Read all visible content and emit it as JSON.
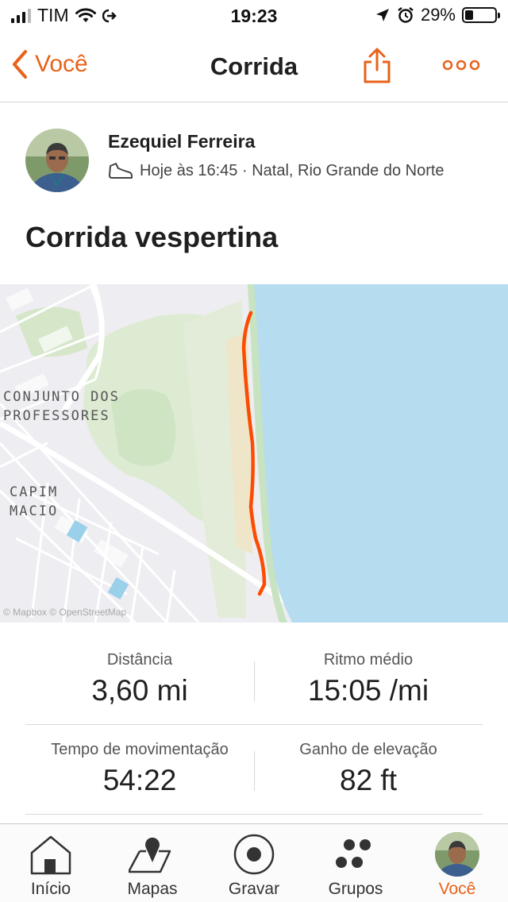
{
  "status_bar": {
    "carrier": "TIM",
    "time": "19:23",
    "battery": "29%",
    "battery_level": 0.29
  },
  "nav": {
    "back_label": "Você",
    "title": "Corrida"
  },
  "athlete": {
    "name": "Ezequiel Ferreira",
    "meta": "Hoje às 16:45 · Natal, Rio Grande do Norte"
  },
  "activity": {
    "title": "Corrida vespertina"
  },
  "map": {
    "labels": {
      "conjunto": "CONJUNTO DOS",
      "professores": "PROFESSORES",
      "capim": "CAPIM",
      "macio": "MACIO"
    },
    "attribution": "© Mapbox © OpenStreetMap",
    "route_color": "#fc4c02",
    "water_color": "#b5dcef"
  },
  "stats": [
    {
      "label": "Distância",
      "value": "3,60 mi"
    },
    {
      "label": "Ritmo médio",
      "value": "15:05 /mi"
    },
    {
      "label": "Tempo de movimentação",
      "value": "54:22"
    },
    {
      "label": "Ganho de elevação",
      "value": "82 ft"
    }
  ],
  "tabs": [
    {
      "label": "Início",
      "icon": "home-icon"
    },
    {
      "label": "Mapas",
      "icon": "map-pin-icon"
    },
    {
      "label": "Gravar",
      "icon": "record-icon"
    },
    {
      "label": "Grupos",
      "icon": "groups-icon"
    },
    {
      "label": "Você",
      "icon": "avatar-icon",
      "active": true
    }
  ],
  "accent_color": "#e8621a"
}
